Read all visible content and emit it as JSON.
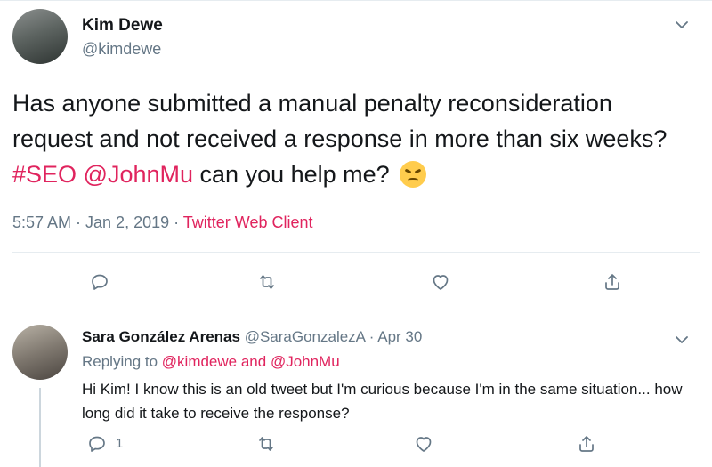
{
  "main_tweet": {
    "author_name": "Kim Dewe",
    "author_handle": "@kimdewe",
    "text_1": "Has anyone submitted a manual penalty reconsideration request and not received a response in more than six weeks? ",
    "hashtag": "#SEO",
    "text_2": " ",
    "mention": "@JohnMu",
    "text_3": " can you help me? ",
    "emoji": "tired-face-emoji",
    "time": "5:57 AM · Jan 2, 2019 · ",
    "client": "Twitter Web Client"
  },
  "reply_tweet": {
    "author_name": "Sara González Arenas",
    "author_handle": "@SaraGonzalezA",
    "separator": " · ",
    "date": "Apr 30",
    "replying_label": "Replying to ",
    "replying_user_1": "@kimdewe",
    "replying_and": " and ",
    "replying_user_2": "@JohnMu",
    "text": "Hi Kim! I know this is an old tweet but I'm curious because I'm in the same situation... how long did it take to receive the response?",
    "reply_count": "1"
  },
  "icons": [
    "chevron-down-icon",
    "reply-icon",
    "retweet-icon",
    "like-icon",
    "share-icon"
  ],
  "colors": {
    "accent": "#e0245e",
    "muted": "#657786",
    "text": "#14171a",
    "border": "#e6ecf0"
  }
}
